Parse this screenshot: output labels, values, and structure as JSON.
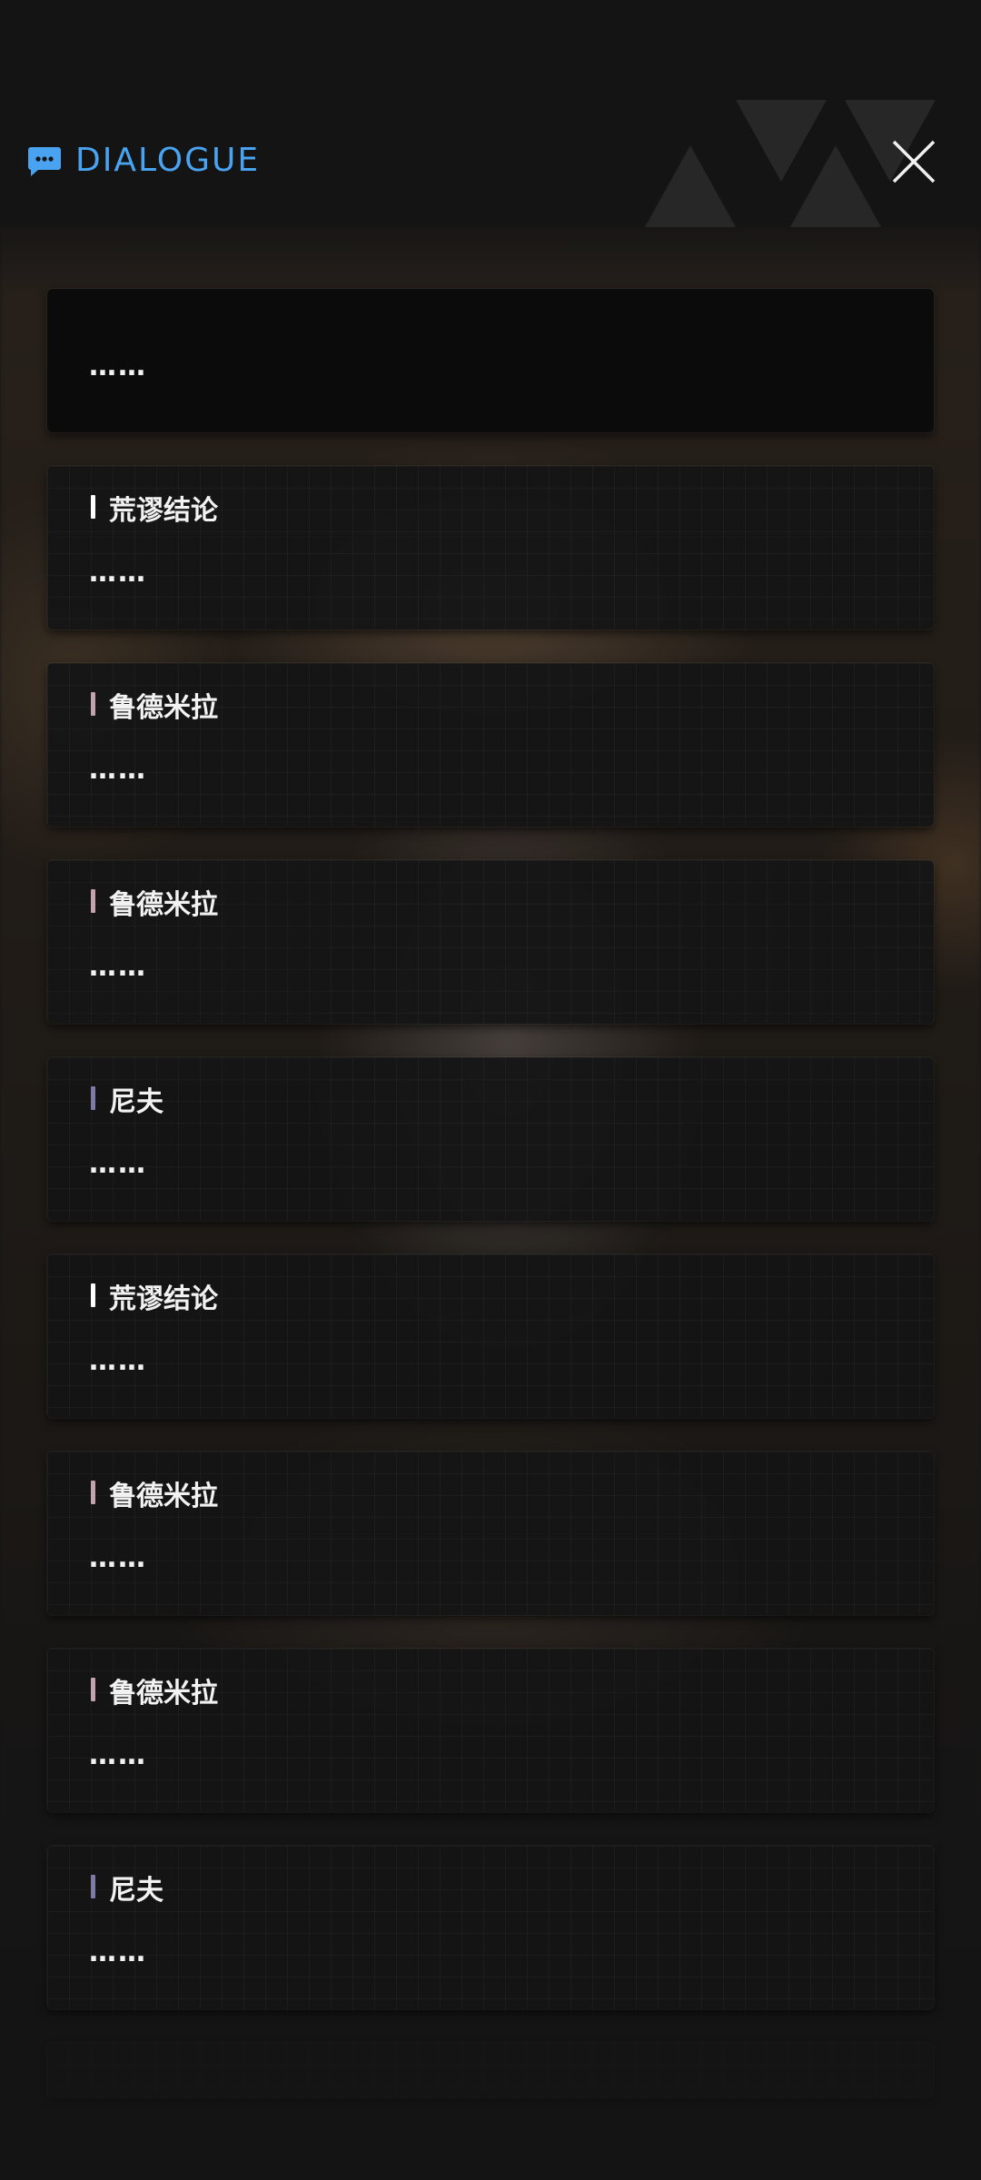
{
  "header": {
    "title": "DIALOGUE",
    "icon": "chat-bubble-icon",
    "accent_color": "#4aa3f0",
    "close_icon": "close-icon"
  },
  "entries": [
    {
      "speaker": "",
      "text": "……",
      "bar_color": ""
    },
    {
      "speaker": "荒谬结论",
      "text": "……",
      "bar_color": "#ffffff"
    },
    {
      "speaker": "鲁德米拉",
      "text": "……",
      "bar_color": "#c4a3ae"
    },
    {
      "speaker": "鲁德米拉",
      "text": "……",
      "bar_color": "#c4a3ae"
    },
    {
      "speaker": "尼夫",
      "text": "……",
      "bar_color": "#7d7aa8"
    },
    {
      "speaker": "荒谬结论",
      "text": "……",
      "bar_color": "#ffffff"
    },
    {
      "speaker": "鲁德米拉",
      "text": "……",
      "bar_color": "#c4a3ae"
    },
    {
      "speaker": "鲁德米拉",
      "text": "……",
      "bar_color": "#c4a3ae"
    },
    {
      "speaker": "尼夫",
      "text": "……",
      "bar_color": "#7d7aa8"
    }
  ]
}
